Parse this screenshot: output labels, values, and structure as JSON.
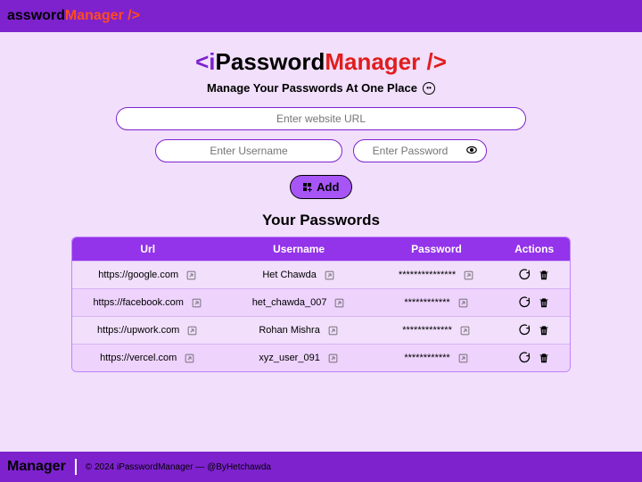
{
  "brand": {
    "pfx_top": "assword",
    "sfx_top": "Manager />",
    "pfx": "<i",
    "mid": "Password",
    "sfx": "Manager />"
  },
  "tagline": "Manage Your Passwords At One Place",
  "inputs": {
    "url": "Enter website URL",
    "user": "Enter Username",
    "pass": "Enter Password"
  },
  "add": "Add",
  "section": "Your Passwords",
  "cols": {
    "c1": "Url",
    "c2": "Username",
    "c3": "Password",
    "c4": "Actions"
  },
  "rows": [
    {
      "url": "https://google.com",
      "user": "Het Chawda",
      "pass": "***************"
    },
    {
      "url": "https://facebook.com",
      "user": "het_chawda_007",
      "pass": "************"
    },
    {
      "url": "https://upwork.com",
      "user": "Rohan Mishra",
      "pass": "*************"
    },
    {
      "url": "https://vercel.com",
      "user": "xyz_user_091",
      "pass": "************"
    }
  ],
  "footer": {
    "logo": "Manager",
    "copy": "© 2024 iPasswordManager — @ByHetchawda"
  }
}
